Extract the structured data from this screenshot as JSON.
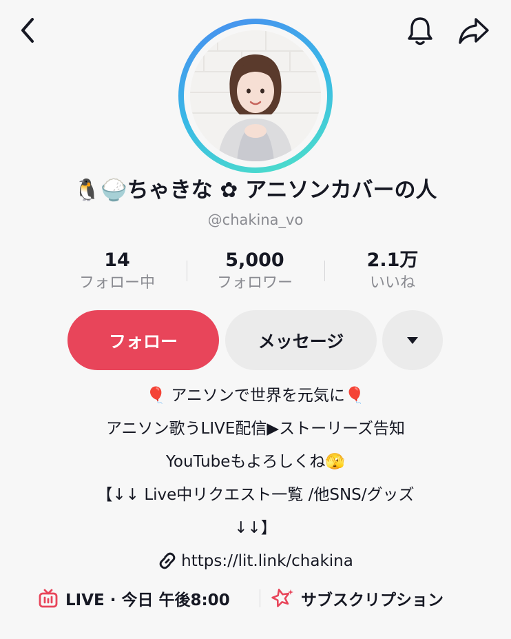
{
  "profile": {
    "display_name": "🐧🍚ちゃきな ✿ アニソンカバーの人",
    "handle": "@chakina_vo"
  },
  "stats": {
    "following": {
      "value": "14",
      "label": "フォロー中"
    },
    "followers": {
      "value": "5,000",
      "label": "フォロワー"
    },
    "likes": {
      "value": "2.1万",
      "label": "いいね"
    }
  },
  "actions": {
    "follow_label": "フォロー",
    "message_label": "メッセージ"
  },
  "bio": {
    "lines": [
      "🎈 アニソンで世界を元気に🎈",
      "アニソン歌うLIVE配信▶ストーリーズ告知",
      "YouTubeもよろしくね🫣",
      "【↓↓ Live中リクエスト一覧 /他SNS/グッズ",
      "↓↓】"
    ],
    "link": "https://lit.link/chakina"
  },
  "bottom": {
    "live_label": "LIVE · 今日 午後8:00",
    "subscription_label": "サブスクリプション"
  },
  "icons": {
    "back": "chevron-left-icon",
    "bell": "bell-icon",
    "share": "share-arrow-icon",
    "more": "caret-down-icon",
    "link": "link-icon",
    "live": "tv-icon",
    "subscription": "star-sparkle-icon"
  },
  "colors": {
    "accent": "#e8455a",
    "secondary_button": "#ebebeb",
    "ring_start": "#4a8cf0",
    "ring_end": "#4fe3c6",
    "muted_text": "#8a8b91"
  }
}
